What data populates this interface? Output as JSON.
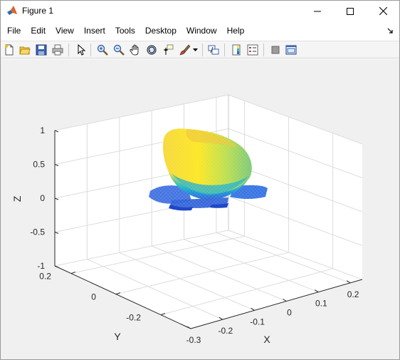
{
  "window": {
    "title": "Figure 1",
    "icon": "matlab-logo-icon"
  },
  "menu": {
    "items": [
      "File",
      "Edit",
      "View",
      "Insert",
      "Tools",
      "Desktop",
      "Window",
      "Help"
    ]
  },
  "toolbar": {
    "buttons": [
      "new-figure-icon",
      "open-file-icon",
      "save-icon",
      "print-icon",
      "edit-plot-icon",
      "zoom-in-icon",
      "zoom-out-icon",
      "pan-icon",
      "rotate-3d-icon",
      "data-cursor-icon",
      "brush-icon",
      "link-plot-icon",
      "colorbar-icon",
      "legend-icon",
      "hide-plot-tools-icon",
      "show-plot-tools-icon"
    ]
  },
  "chart_data": {
    "type": "surface-3d",
    "title": "",
    "xlabel": "X",
    "ylabel": "Y",
    "zlabel": "Z",
    "xlim": [
      -0.3,
      0.3
    ],
    "ylim": [
      -0.3,
      0.3
    ],
    "zlim": [
      -1,
      1
    ],
    "xticks": [
      "-0.3",
      "-0.2",
      "-0.1",
      "0",
      "0.1",
      "0.2"
    ],
    "yticks": [
      "-0.2",
      "0",
      "0.2"
    ],
    "zticks": [
      "-1",
      "-0.5",
      "0",
      "0.5",
      "1"
    ],
    "grid": true,
    "colormap": [
      "#3d5dd8",
      "#1c9ad8",
      "#2fc1b7",
      "#8ccf6e",
      "#f2e64a",
      "#fde725"
    ]
  }
}
